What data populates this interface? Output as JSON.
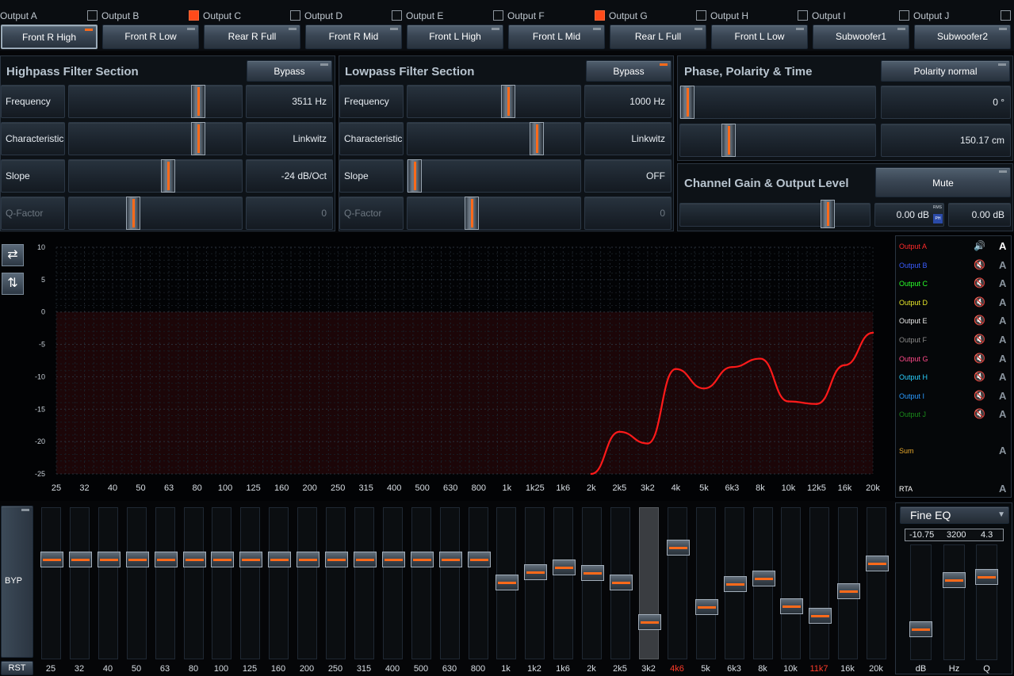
{
  "outputs": [
    {
      "label": "Output A",
      "checked": false,
      "button": "Front R High",
      "selected": true,
      "led": true
    },
    {
      "label": "Output B",
      "checked": true,
      "button": "Front R Low",
      "selected": false,
      "led": false
    },
    {
      "label": "Output C",
      "checked": false,
      "button": "Rear R Full",
      "selected": false,
      "led": false
    },
    {
      "label": "Output D",
      "checked": false,
      "button": "Front R Mid",
      "selected": false,
      "led": false
    },
    {
      "label": "Output E",
      "checked": false,
      "button": "Front L High",
      "selected": false,
      "led": false
    },
    {
      "label": "Output F",
      "checked": true,
      "button": "Front L Mid",
      "selected": false,
      "led": false
    },
    {
      "label": "Output G",
      "checked": false,
      "button": "Rear L Full",
      "selected": false,
      "led": false
    },
    {
      "label": "Output H",
      "checked": false,
      "button": "Front L Low",
      "selected": false,
      "led": false
    },
    {
      "label": "Output I",
      "checked": false,
      "button": "Subwoofer1",
      "selected": false,
      "led": false
    },
    {
      "label": "Output J",
      "checked": false,
      "button": "Subwoofer2",
      "selected": false,
      "led": false
    }
  ],
  "highpass": {
    "title": "Highpass Filter Section",
    "bypass_label": "Bypass",
    "rows": [
      {
        "label": "Frequency",
        "value": "3511 Hz",
        "level": 0.77,
        "dim": false
      },
      {
        "label": "Characteristic",
        "value": "Linkwitz",
        "level": 0.77,
        "dim": false
      },
      {
        "label": "Slope",
        "value": "-24 dB/Oct",
        "level": 0.58,
        "dim": false
      },
      {
        "label": "Q-Factor",
        "value": "0",
        "level": 0.36,
        "dim": true
      }
    ]
  },
  "lowpass": {
    "title": "Lowpass Filter Section",
    "bypass_label": "Bypass",
    "rows": [
      {
        "label": "Frequency",
        "value": "1000 Hz",
        "level": 0.59,
        "dim": false
      },
      {
        "label": "Characteristic",
        "value": "Linkwitz",
        "level": 0.77,
        "dim": false
      },
      {
        "label": "Slope",
        "value": "OFF",
        "level": 0.0,
        "dim": false
      },
      {
        "label": "Q-Factor",
        "value": "0",
        "level": 0.36,
        "dim": true
      }
    ]
  },
  "phase": {
    "title": "Phase, Polarity & Time",
    "polarity_label": "Polarity normal",
    "phase_value": "0 °",
    "phase_level": 0.0,
    "time_value": "150.17 cm",
    "time_level": 0.23
  },
  "gain": {
    "title": "Channel Gain & Output Level",
    "mute_label": "Mute",
    "gain_level": 0.8,
    "gain_value": "0.00 dB",
    "level_value": "0.00 dB",
    "rms_label": "RMS",
    "ph_label": "PH"
  },
  "chart_data": {
    "type": "line",
    "x_ticks": [
      "25",
      "32",
      "40",
      "50",
      "63",
      "80",
      "100",
      "125",
      "160",
      "200",
      "250",
      "315",
      "400",
      "500",
      "630",
      "800",
      "1k",
      "1k25",
      "1k6",
      "2k",
      "2k5",
      "3k2",
      "4k",
      "5k",
      "6k3",
      "8k",
      "10k",
      "12k5",
      "16k",
      "20k"
    ],
    "ylim": [
      -25,
      10
    ],
    "y_ticks": [
      10,
      5,
      0,
      -5,
      -10,
      -15,
      -20,
      -25
    ],
    "series": [
      {
        "name": "Output A",
        "color": "#ff1a1a",
        "x": [
          "2k",
          "2k5",
          "3k2",
          "4k",
          "5k",
          "6k3",
          "8k",
          "10k",
          "12k5",
          "16k",
          "20k"
        ],
        "y": [
          -25,
          -18.5,
          -20.3,
          -8.8,
          -11.8,
          -8.5,
          -7.2,
          -13.8,
          -14.2,
          -8.2,
          -3.2
        ]
      }
    ]
  },
  "legend": [
    {
      "label": "Output A",
      "color": "#ff2a2a",
      "icon": "speaker-on-icon",
      "active": true
    },
    {
      "label": "Output B",
      "color": "#3a5cff",
      "icon": "speaker-muted-icon",
      "active": false
    },
    {
      "label": "Output C",
      "color": "#2aff2a",
      "icon": "speaker-muted-icon",
      "active": false
    },
    {
      "label": "Output D",
      "color": "#e8e82a",
      "icon": "speaker-muted-icon",
      "active": false
    },
    {
      "label": "Output E",
      "color": "#e8e8e8",
      "icon": "speaker-muted-icon",
      "active": false
    },
    {
      "label": "Output F",
      "color": "#8a8a8a",
      "icon": "speaker-muted-icon",
      "active": false
    },
    {
      "label": "Output G",
      "color": "#ff4a8a",
      "icon": "speaker-muted-icon",
      "active": false
    },
    {
      "label": "Output H",
      "color": "#2ad0ff",
      "icon": "speaker-muted-icon",
      "active": false
    },
    {
      "label": "Output I",
      "color": "#2a9aff",
      "icon": "speaker-muted-icon",
      "active": false
    },
    {
      "label": "Output J",
      "color": "#1a8a1a",
      "icon": "speaker-muted-icon",
      "active": false
    }
  ],
  "legend_extra": {
    "sum": "Sum",
    "rta": "RTA",
    "a_label": "A"
  },
  "eq": {
    "byp_label": "BYP",
    "rst_label": "RST",
    "bands": [
      {
        "label": "25",
        "level": 0.68,
        "red": false
      },
      {
        "label": "32",
        "level": 0.68,
        "red": false
      },
      {
        "label": "40",
        "level": 0.68,
        "red": false
      },
      {
        "label": "50",
        "level": 0.68,
        "red": false
      },
      {
        "label": "63",
        "level": 0.68,
        "red": false
      },
      {
        "label": "80",
        "level": 0.68,
        "red": false
      },
      {
        "label": "100",
        "level": 0.68,
        "red": false
      },
      {
        "label": "125",
        "level": 0.68,
        "red": false
      },
      {
        "label": "160",
        "level": 0.68,
        "red": false
      },
      {
        "label": "200",
        "level": 0.68,
        "red": false
      },
      {
        "label": "250",
        "level": 0.68,
        "red": false
      },
      {
        "label": "315",
        "level": 0.68,
        "red": false
      },
      {
        "label": "400",
        "level": 0.68,
        "red": false
      },
      {
        "label": "500",
        "level": 0.68,
        "red": false
      },
      {
        "label": "630",
        "level": 0.68,
        "red": false
      },
      {
        "label": "800",
        "level": 0.68,
        "red": false
      },
      {
        "label": "1k",
        "level": 0.51,
        "red": false
      },
      {
        "label": "1k2",
        "level": 0.59,
        "red": false
      },
      {
        "label": "1k6",
        "level": 0.62,
        "red": false
      },
      {
        "label": "2k",
        "level": 0.58,
        "red": false
      },
      {
        "label": "2k5",
        "level": 0.51,
        "red": false
      },
      {
        "label": "3k2",
        "level": 0.22,
        "red": false,
        "selected": true
      },
      {
        "label": "4k6",
        "level": 0.77,
        "red": true
      },
      {
        "label": "5k",
        "level": 0.33,
        "red": false
      },
      {
        "label": "6k3",
        "level": 0.5,
        "red": false
      },
      {
        "label": "8k",
        "level": 0.54,
        "red": false
      },
      {
        "label": "10k",
        "level": 0.34,
        "red": false
      },
      {
        "label": "11k7",
        "level": 0.27,
        "red": true
      },
      {
        "label": "16k",
        "level": 0.45,
        "red": false
      },
      {
        "label": "20k",
        "level": 0.65,
        "red": false
      }
    ]
  },
  "fine_eq": {
    "title": "Fine EQ",
    "db_value": "-10.75",
    "hz_value": "3200",
    "q_value": "4.3",
    "db_label": "dB",
    "hz_label": "Hz",
    "q_label": "Q",
    "db_level": 0.24,
    "hz_level": 0.73,
    "q_level": 0.76
  }
}
